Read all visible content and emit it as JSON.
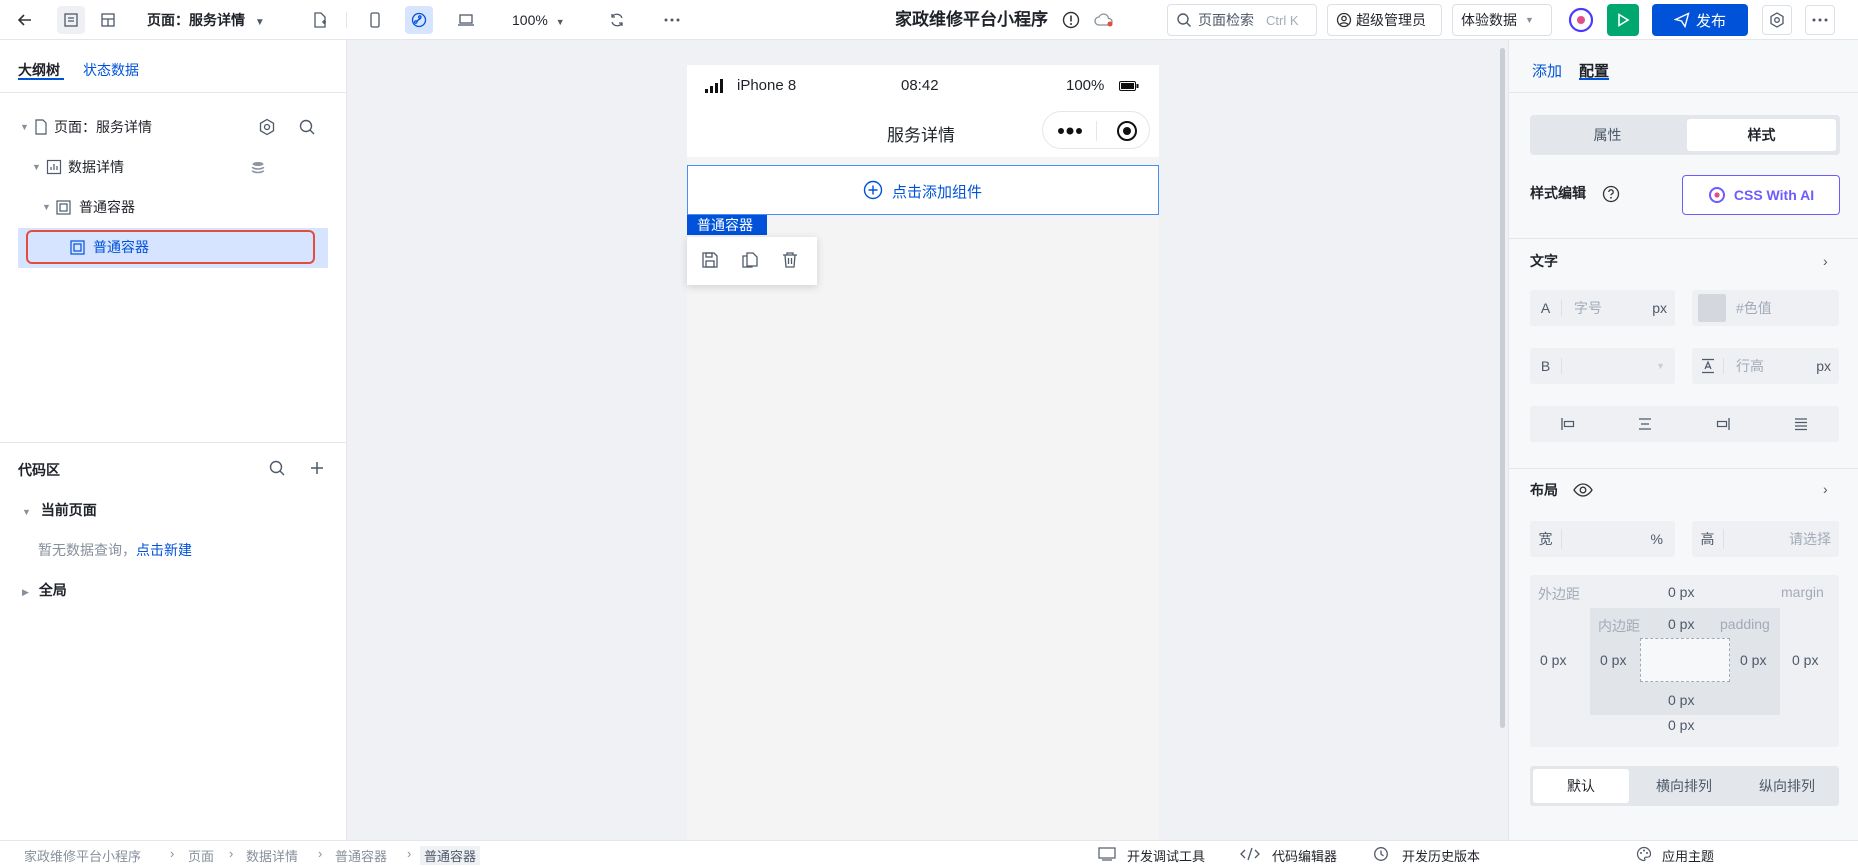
{
  "topbar": {
    "page_selector": "页面：服务详情",
    "zoom": "100%",
    "app_title": "家政维修平台小程序",
    "search_placeholder": "页面检索",
    "search_shortcut": "Ctrl K",
    "user_label": "超级管理员",
    "env_label": "体验数据",
    "publish_label": "发布"
  },
  "left": {
    "tabs": [
      "大纲树",
      "状态数据"
    ],
    "tree": [
      {
        "label": "页面：服务详情"
      },
      {
        "label": "数据详情"
      },
      {
        "label": "普通容器"
      },
      {
        "label": "普通容器"
      }
    ],
    "code": {
      "title": "代码区",
      "current_page": "当前页面",
      "empty_text": "暂无数据查询，",
      "create_link": "点击新建",
      "global": "全局"
    }
  },
  "phone": {
    "device": "iPhone 8",
    "time": "08:42",
    "battery": "100%",
    "title": "服务详情",
    "add_component": "点击添加组件",
    "selected_tag": "普通容器"
  },
  "right": {
    "tabs": [
      "添加",
      "配置"
    ],
    "seg": [
      "属性",
      "样式"
    ],
    "style_edit": "样式编辑",
    "css_ai": "CSS With AI",
    "text_section": "文字",
    "font_size_prefix": "A",
    "font_size_placeholder": "字号",
    "unit_px": "px",
    "color_placeholder": "#色值",
    "weight_prefix": "B",
    "line_height_placeholder": "行高",
    "layout_section": "布局",
    "width_label": "宽",
    "width_unit": "%",
    "height_label": "高",
    "height_placeholder": "请选择",
    "margin_label": "外边距",
    "margin_en": "margin",
    "padding_label": "内边距",
    "padding_en": "padding",
    "zero_px": "0 px",
    "layout_modes": [
      "默认",
      "横向排列",
      "纵向排列"
    ]
  },
  "bottom": {
    "breadcrumb": [
      "家政维修平台小程序",
      "页面",
      "数据详情",
      "普通容器",
      "普通容器"
    ],
    "tools": [
      "开发调试工具",
      "代码编辑器",
      "开发历史版本",
      "应用主题"
    ]
  },
  "colors": {
    "accent": "#0052d9",
    "play": "#00a870",
    "selected_outline": "#e34d3b"
  }
}
